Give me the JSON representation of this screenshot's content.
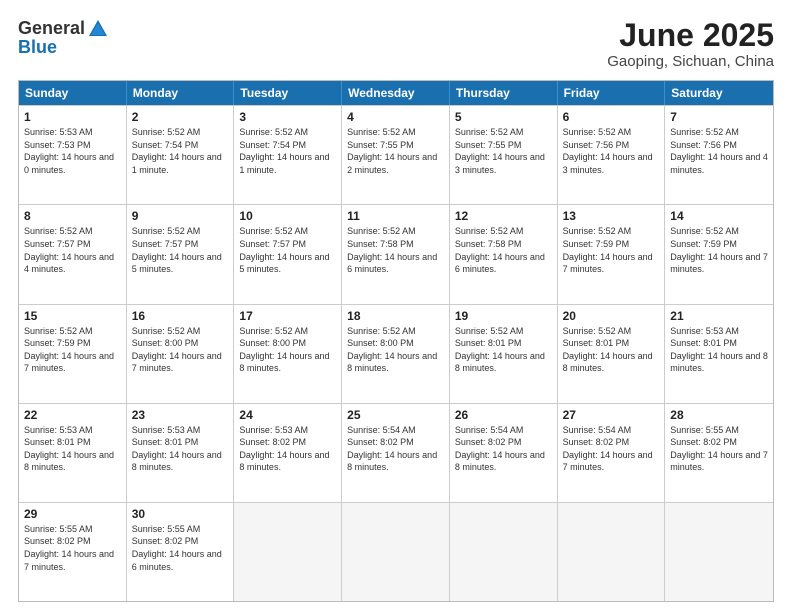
{
  "header": {
    "logo_general": "General",
    "logo_blue": "Blue",
    "month_title": "June 2025",
    "location": "Gaoping, Sichuan, China"
  },
  "calendar": {
    "days_of_week": [
      "Sunday",
      "Monday",
      "Tuesday",
      "Wednesday",
      "Thursday",
      "Friday",
      "Saturday"
    ],
    "weeks": [
      [
        {
          "day": "",
          "empty": true
        },
        {
          "day": "",
          "empty": true
        },
        {
          "day": "",
          "empty": true
        },
        {
          "day": "",
          "empty": true
        },
        {
          "day": "",
          "empty": true
        },
        {
          "day": "",
          "empty": true
        },
        {
          "day": "",
          "empty": true
        }
      ],
      [
        {
          "day": "1",
          "sunrise": "5:53 AM",
          "sunset": "7:53 PM",
          "daylight": "14 hours and 0 minutes."
        },
        {
          "day": "2",
          "sunrise": "5:52 AM",
          "sunset": "7:54 PM",
          "daylight": "14 hours and 1 minute."
        },
        {
          "day": "3",
          "sunrise": "5:52 AM",
          "sunset": "7:54 PM",
          "daylight": "14 hours and 1 minute."
        },
        {
          "day": "4",
          "sunrise": "5:52 AM",
          "sunset": "7:55 PM",
          "daylight": "14 hours and 2 minutes."
        },
        {
          "day": "5",
          "sunrise": "5:52 AM",
          "sunset": "7:55 PM",
          "daylight": "14 hours and 3 minutes."
        },
        {
          "day": "6",
          "sunrise": "5:52 AM",
          "sunset": "7:56 PM",
          "daylight": "14 hours and 3 minutes."
        },
        {
          "day": "7",
          "sunrise": "5:52 AM",
          "sunset": "7:56 PM",
          "daylight": "14 hours and 4 minutes."
        }
      ],
      [
        {
          "day": "8",
          "sunrise": "5:52 AM",
          "sunset": "7:57 PM",
          "daylight": "14 hours and 4 minutes."
        },
        {
          "day": "9",
          "sunrise": "5:52 AM",
          "sunset": "7:57 PM",
          "daylight": "14 hours and 5 minutes."
        },
        {
          "day": "10",
          "sunrise": "5:52 AM",
          "sunset": "7:57 PM",
          "daylight": "14 hours and 5 minutes."
        },
        {
          "day": "11",
          "sunrise": "5:52 AM",
          "sunset": "7:58 PM",
          "daylight": "14 hours and 6 minutes."
        },
        {
          "day": "12",
          "sunrise": "5:52 AM",
          "sunset": "7:58 PM",
          "daylight": "14 hours and 6 minutes."
        },
        {
          "day": "13",
          "sunrise": "5:52 AM",
          "sunset": "7:59 PM",
          "daylight": "14 hours and 7 minutes."
        },
        {
          "day": "14",
          "sunrise": "5:52 AM",
          "sunset": "7:59 PM",
          "daylight": "14 hours and 7 minutes."
        }
      ],
      [
        {
          "day": "15",
          "sunrise": "5:52 AM",
          "sunset": "7:59 PM",
          "daylight": "14 hours and 7 minutes."
        },
        {
          "day": "16",
          "sunrise": "5:52 AM",
          "sunset": "8:00 PM",
          "daylight": "14 hours and 7 minutes."
        },
        {
          "day": "17",
          "sunrise": "5:52 AM",
          "sunset": "8:00 PM",
          "daylight": "14 hours and 8 minutes."
        },
        {
          "day": "18",
          "sunrise": "5:52 AM",
          "sunset": "8:00 PM",
          "daylight": "14 hours and 8 minutes."
        },
        {
          "day": "19",
          "sunrise": "5:52 AM",
          "sunset": "8:01 PM",
          "daylight": "14 hours and 8 minutes."
        },
        {
          "day": "20",
          "sunrise": "5:52 AM",
          "sunset": "8:01 PM",
          "daylight": "14 hours and 8 minutes."
        },
        {
          "day": "21",
          "sunrise": "5:53 AM",
          "sunset": "8:01 PM",
          "daylight": "14 hours and 8 minutes."
        }
      ],
      [
        {
          "day": "22",
          "sunrise": "5:53 AM",
          "sunset": "8:01 PM",
          "daylight": "14 hours and 8 minutes."
        },
        {
          "day": "23",
          "sunrise": "5:53 AM",
          "sunset": "8:01 PM",
          "daylight": "14 hours and 8 minutes."
        },
        {
          "day": "24",
          "sunrise": "5:53 AM",
          "sunset": "8:02 PM",
          "daylight": "14 hours and 8 minutes."
        },
        {
          "day": "25",
          "sunrise": "5:54 AM",
          "sunset": "8:02 PM",
          "daylight": "14 hours and 8 minutes."
        },
        {
          "day": "26",
          "sunrise": "5:54 AM",
          "sunset": "8:02 PM",
          "daylight": "14 hours and 8 minutes."
        },
        {
          "day": "27",
          "sunrise": "5:54 AM",
          "sunset": "8:02 PM",
          "daylight": "14 hours and 7 minutes."
        },
        {
          "day": "28",
          "sunrise": "5:55 AM",
          "sunset": "8:02 PM",
          "daylight": "14 hours and 7 minutes."
        }
      ],
      [
        {
          "day": "29",
          "sunrise": "5:55 AM",
          "sunset": "8:02 PM",
          "daylight": "14 hours and 7 minutes."
        },
        {
          "day": "30",
          "sunrise": "5:55 AM",
          "sunset": "8:02 PM",
          "daylight": "14 hours and 6 minutes."
        },
        {
          "day": "",
          "empty": true
        },
        {
          "day": "",
          "empty": true
        },
        {
          "day": "",
          "empty": true
        },
        {
          "day": "",
          "empty": true
        },
        {
          "day": "",
          "empty": true
        }
      ]
    ]
  }
}
